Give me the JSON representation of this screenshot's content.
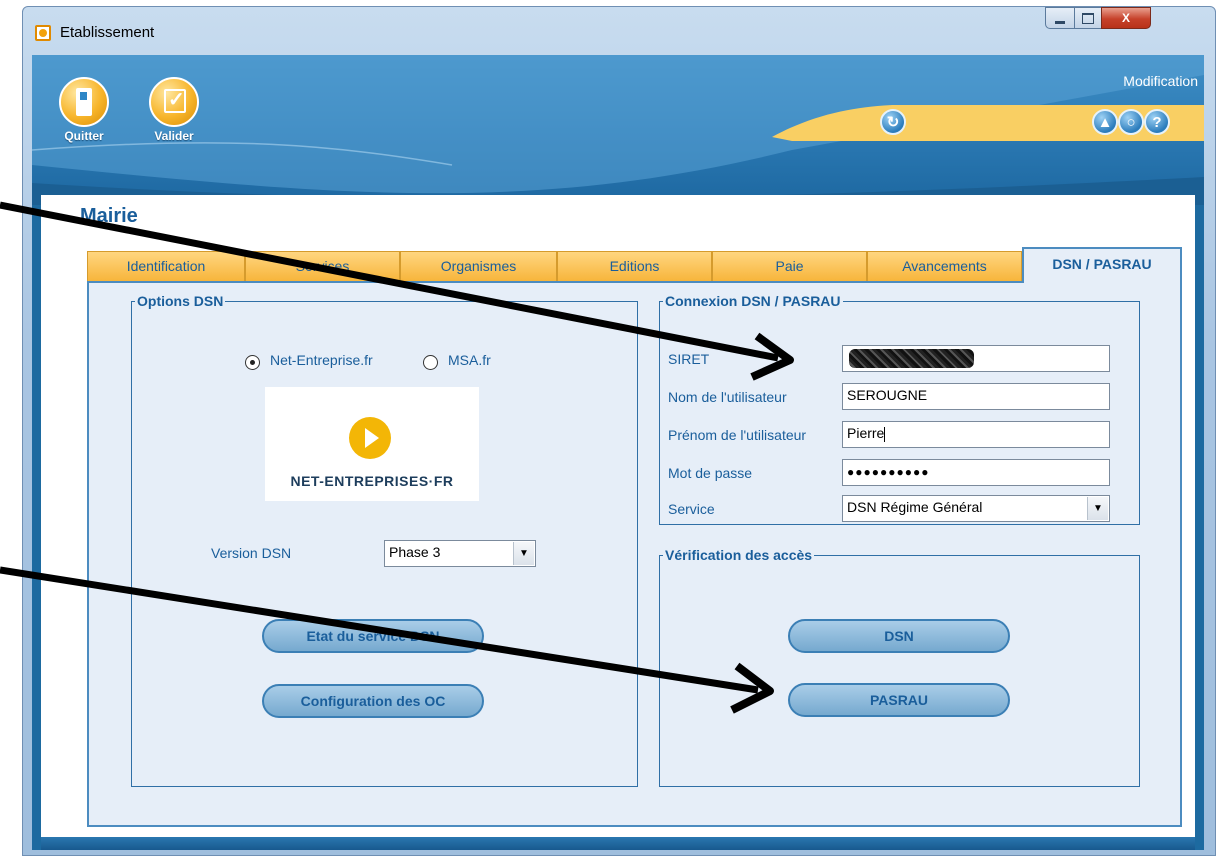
{
  "window": {
    "title": "Etablissement",
    "controls": {
      "minimize": "",
      "maximize": "",
      "close": "X"
    }
  },
  "header": {
    "mode": "Modification",
    "toolbar": [
      {
        "label": "Quitter",
        "icon": "door-exit-icon"
      },
      {
        "label": "Valider",
        "icon": "checkmark-validate-icon"
      }
    ],
    "right_icons": [
      "refresh-icon",
      "graduation-cap-icon",
      "support-icon",
      "help-icon"
    ],
    "help_glyph": "?"
  },
  "org_title": "Mairie",
  "tabs": [
    {
      "label": "Identification",
      "active": false
    },
    {
      "label": "Services",
      "active": false
    },
    {
      "label": "Organismes",
      "active": false
    },
    {
      "label": "Editions",
      "active": false
    },
    {
      "label": "Paie",
      "active": false
    },
    {
      "label": "Avancements",
      "active": false
    },
    {
      "label": "DSN / PASRAU",
      "active": true
    }
  ],
  "options_dsn": {
    "legend": "Options DSN",
    "radio_options": [
      {
        "label": "Net-Entreprise.fr",
        "selected": true
      },
      {
        "label": "MSA.fr",
        "selected": false
      }
    ],
    "logo_text": "NET-ENTREPRISES·FR",
    "version_label": "Version DSN",
    "version_value": "Phase 3",
    "buttons": {
      "state": "Etat du service DSN",
      "config": "Configuration des OC"
    }
  },
  "connexion": {
    "legend": "Connexion DSN / PASRAU",
    "fields": {
      "siret": {
        "label": "SIRET",
        "value": ""
      },
      "nom": {
        "label": "Nom de l'utilisateur",
        "value": "SEROUGNE"
      },
      "prenom": {
        "label": "Prénom de l'utilisateur",
        "value": "Pierre"
      },
      "password": {
        "label": "Mot de passe",
        "value": "●●●●●●●●●●"
      },
      "service": {
        "label": "Service",
        "value": "DSN Régime Général"
      }
    }
  },
  "verification": {
    "legend": "Vérification des accès",
    "buttons": {
      "dsn": "DSN",
      "pasrau": "PASRAU"
    }
  },
  "colors": {
    "accent_orange": "#f7b53b",
    "brand_blue": "#1a5e9b",
    "panel_bg": "#e6eef8"
  }
}
